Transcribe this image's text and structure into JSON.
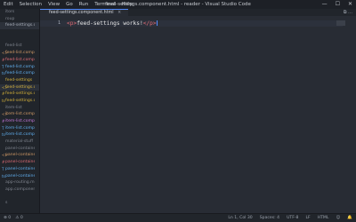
{
  "menu": [
    "Edit",
    "Selection",
    "View",
    "Go",
    "Run",
    "Terminal",
    "Help"
  ],
  "window_title": "feed-settings.component.html - reader - Visual Studio Code",
  "window_controls": {
    "minimize": "—",
    "maximize": "☐",
    "close": "✕"
  },
  "sidebar": {
    "items": [
      {
        "label": "itors",
        "icon": "",
        "badge": "",
        "color": "gray"
      },
      {
        "label": "roup",
        "icon": "",
        "badge": "",
        "color": "gray"
      },
      {
        "label": "feed-settings.co...",
        "icon": "",
        "badge": "",
        "color": "light",
        "active": true
      },
      {
        "label": "",
        "icon": "",
        "badge": "",
        "color": "gray"
      },
      {
        "label": "",
        "icon": "",
        "badge": "",
        "color": "gray"
      },
      {
        "label": "feed-list",
        "icon": "",
        "badge": "",
        "color": "gray"
      },
      {
        "label": "feed-list.compone...",
        "icon": "<>",
        "badge": "",
        "color": "orange"
      },
      {
        "label": "feed-list.compon...",
        "icon": "#",
        "badge": "",
        "color": "red"
      },
      {
        "label": "feed-list.compon...",
        "icon": "T",
        "badge": "",
        "color": "blue"
      },
      {
        "label": "feed-list.compo...",
        "icon": "ts",
        "badge": "",
        "color": "blue"
      },
      {
        "label": "feed-settings",
        "icon": "",
        "badge": "",
        "color": "yellow"
      },
      {
        "label": "feed-settings.co...",
        "icon": "<>",
        "badge": "",
        "color": "yellow",
        "active": true
      },
      {
        "label": "feed-settings.c...",
        "icon": "#",
        "badge": "",
        "color": "yellow"
      },
      {
        "label": "feed-settings.c...",
        "icon": "ts",
        "badge": "",
        "color": "yellow"
      },
      {
        "label": "item-list",
        "icon": "",
        "badge": "",
        "color": "gray"
      },
      {
        "label": "item-list.compo...",
        "icon": "<>",
        "badge": "",
        "color": "orange"
      },
      {
        "label": "item-list.compo...",
        "icon": "#",
        "badge": "",
        "color": "purple"
      },
      {
        "label": "item-list.compo...",
        "icon": "T",
        "badge": "",
        "color": "blue"
      },
      {
        "label": "item-list.compo...",
        "icon": "ts",
        "badge": "",
        "color": "blue"
      },
      {
        "label": "material-stuff",
        "icon": "",
        "badge": "",
        "color": "gray"
      },
      {
        "label": "panel-container",
        "icon": "",
        "badge": "",
        "color": "gray"
      },
      {
        "label": "panel-container.co...",
        "icon": "<>",
        "badge": "",
        "color": "orange"
      },
      {
        "label": "panel-container.co...",
        "icon": "#",
        "badge": "",
        "color": "red"
      },
      {
        "label": "panel-container.co...",
        "icon": "T",
        "badge": "",
        "color": "blue"
      },
      {
        "label": "panel-container.c...",
        "icon": "ts",
        "badge": "",
        "color": "blue"
      },
      {
        "label": "app-routing.modul...",
        "icon": "",
        "badge": "",
        "color": "gray"
      },
      {
        "label": "app.component.ht...",
        "icon": "",
        "badge": "",
        "color": "gray"
      },
      {
        "label": "",
        "icon": "",
        "badge": "",
        "color": "gray"
      },
      {
        "label": "s",
        "icon": "",
        "badge": "",
        "color": "gray"
      }
    ]
  },
  "tab": {
    "label": "feed-settings.component.html",
    "close": "×"
  },
  "split_label": "⧉ …",
  "editor": {
    "line_number": "1",
    "code": {
      "open": "<p>",
      "text": "feed-settings works!",
      "close": "</p>"
    }
  },
  "status": {
    "left": [
      "⊗ 0",
      "⚠ 0"
    ],
    "right": [
      "Ln 1, Col 30",
      "Spaces: 4",
      "UTF-8",
      "LF",
      "HTML",
      "☺",
      "🔔"
    ]
  }
}
